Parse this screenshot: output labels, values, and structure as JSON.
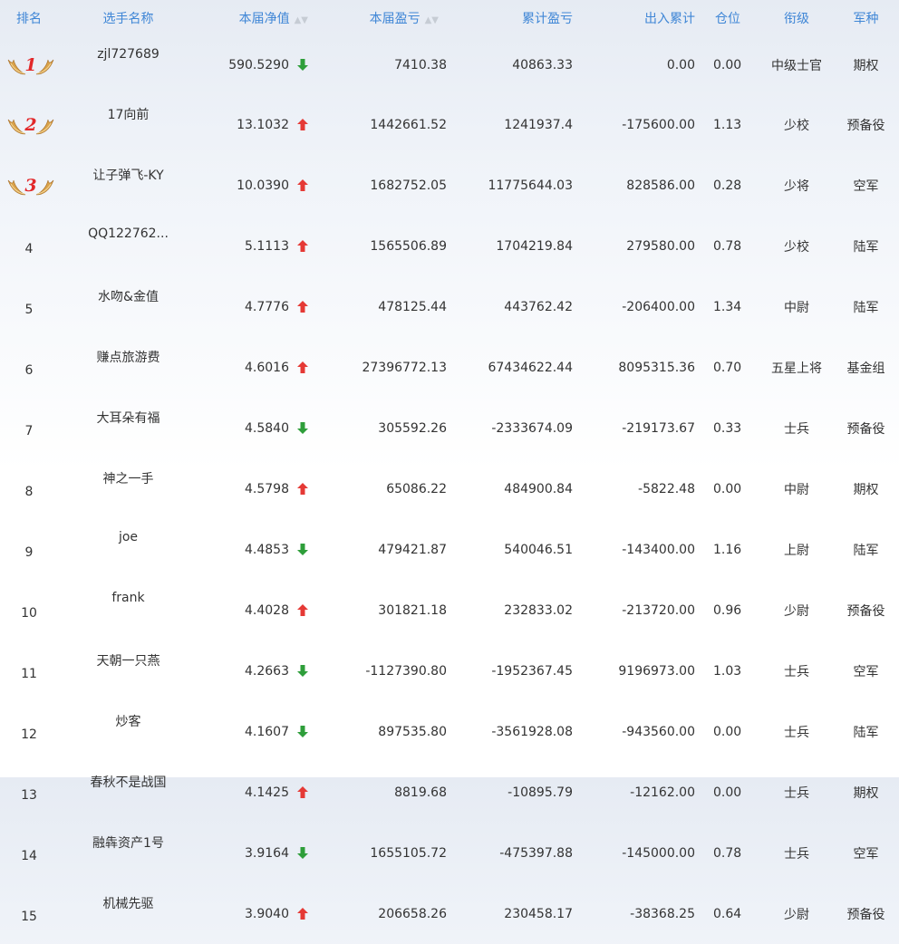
{
  "headers": {
    "rank": "排名",
    "name": "选手名称",
    "nav": "本届净值",
    "pnl": "本届盈亏",
    "cum": "累计盈亏",
    "flow": "出入累计",
    "pos": "仓位",
    "title": "衔级",
    "branch": "军种"
  },
  "colors": {
    "header": "#3f86d6",
    "up": "#e53935",
    "down": "#2e9e3a",
    "medal_num": "#e2282a"
  },
  "rows": [
    {
      "rank": "1",
      "name": "zjl727689",
      "nav": "590.5290",
      "dir": "down",
      "pnl": "7410.38",
      "cum": "40863.33",
      "flow": "0.00",
      "pos": "0.00",
      "title": "中级士官",
      "branch": "期权"
    },
    {
      "rank": "2",
      "name": "17向前",
      "nav": "13.1032",
      "dir": "up",
      "pnl": "1442661.52",
      "cum": "1241937.4",
      "flow": "-175600.00",
      "pos": "1.13",
      "title": "少校",
      "branch": "预备役"
    },
    {
      "rank": "3",
      "name": "让子弹飞-KY",
      "nav": "10.0390",
      "dir": "up",
      "pnl": "1682752.05",
      "cum": "11775644.03",
      "flow": "828586.00",
      "pos": "0.28",
      "title": "少将",
      "branch": "空军"
    },
    {
      "rank": "4",
      "name": "QQ122762...",
      "nav": "5.1113",
      "dir": "up",
      "pnl": "1565506.89",
      "cum": "1704219.84",
      "flow": "279580.00",
      "pos": "0.78",
      "title": "少校",
      "branch": "陆军"
    },
    {
      "rank": "5",
      "name": "水吻&金值",
      "nav": "4.7776",
      "dir": "up",
      "pnl": "478125.44",
      "cum": "443762.42",
      "flow": "-206400.00",
      "pos": "1.34",
      "title": "中尉",
      "branch": "陆军"
    },
    {
      "rank": "6",
      "name": "赚点旅游费",
      "nav": "4.6016",
      "dir": "up",
      "pnl": "27396772.13",
      "cum": "67434622.44",
      "flow": "8095315.36",
      "pos": "0.70",
      "title": "五星上将",
      "branch": "基金组"
    },
    {
      "rank": "7",
      "name": "大耳朵有福",
      "nav": "4.5840",
      "dir": "down",
      "pnl": "305592.26",
      "cum": "-2333674.09",
      "flow": "-219173.67",
      "pos": "0.33",
      "title": "士兵",
      "branch": "预备役"
    },
    {
      "rank": "8",
      "name": "神之一手",
      "nav": "4.5798",
      "dir": "up",
      "pnl": "65086.22",
      "cum": "484900.84",
      "flow": "-5822.48",
      "pos": "0.00",
      "title": "中尉",
      "branch": "期权"
    },
    {
      "rank": "9",
      "name": "joe",
      "nav": "4.4853",
      "dir": "down",
      "pnl": "479421.87",
      "cum": "540046.51",
      "flow": "-143400.00",
      "pos": "1.16",
      "title": "上尉",
      "branch": "陆军"
    },
    {
      "rank": "10",
      "name": "frank",
      "nav": "4.4028",
      "dir": "up",
      "pnl": "301821.18",
      "cum": "232833.02",
      "flow": "-213720.00",
      "pos": "0.96",
      "title": "少尉",
      "branch": "预备役"
    },
    {
      "rank": "11",
      "name": "天朝一只燕",
      "nav": "4.2663",
      "dir": "down",
      "pnl": "-1127390.80",
      "cum": "-1952367.45",
      "flow": "9196973.00",
      "pos": "1.03",
      "title": "士兵",
      "branch": "空军"
    },
    {
      "rank": "12",
      "name": "炒客",
      "nav": "4.1607",
      "dir": "down",
      "pnl": "897535.80",
      "cum": "-3561928.08",
      "flow": "-943560.00",
      "pos": "0.00",
      "title": "士兵",
      "branch": "陆军"
    },
    {
      "rank": "13",
      "name": "春秋不是战国",
      "nav": "4.1425",
      "dir": "up",
      "pnl": "8819.68",
      "cum": "-10895.79",
      "flow": "-12162.00",
      "pos": "0.00",
      "title": "士兵",
      "branch": "期权"
    },
    {
      "rank": "14",
      "name": "融犇资产1号",
      "nav": "3.9164",
      "dir": "down",
      "pnl": "1655105.72",
      "cum": "-475397.88",
      "flow": "-145000.00",
      "pos": "0.78",
      "title": "士兵",
      "branch": "空军"
    },
    {
      "rank": "15",
      "name": "机械先驱",
      "nav": "3.9040",
      "dir": "up",
      "pnl": "206658.26",
      "cum": "230458.17",
      "flow": "-38368.25",
      "pos": "0.64",
      "title": "少尉",
      "branch": "预备役"
    }
  ]
}
